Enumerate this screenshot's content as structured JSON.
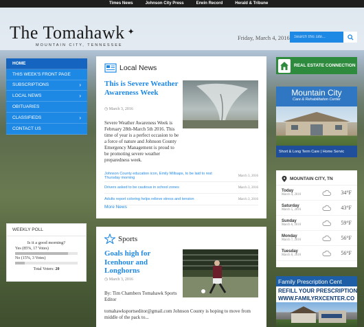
{
  "topbar": {
    "links": [
      "Times News",
      "Johnson City Press",
      "Erwin Record",
      "Herald & Tribune"
    ]
  },
  "header": {
    "logo": "The Tomahawk",
    "tagline": "MOUNTAIN CITY, TENNESSEE",
    "date": "Friday, March 4, 2016",
    "search_placeholder": "Search this site..."
  },
  "nav": {
    "items": [
      {
        "label": "HOME",
        "chev": ""
      },
      {
        "label": "THIS WEEK'S FRONT PAGE",
        "chev": ""
      },
      {
        "label": "SUBSCRIPTIONS",
        "chev": "›"
      },
      {
        "label": "LOCAL NEWS",
        "chev": "›"
      },
      {
        "label": "OBITUARIES",
        "chev": ""
      },
      {
        "label": "CLASSIFIEDS",
        "chev": "›"
      },
      {
        "label": "CONTACT US",
        "chev": ""
      }
    ]
  },
  "poll": {
    "title": "WEEKLY POLL",
    "question": "Is it a good morning?",
    "answers": [
      {
        "label": "Yes (85%, 17 Votes)",
        "percent": 85
      },
      {
        "label": "No (15%, 3 Votes)",
        "percent": 15
      }
    ],
    "total_label": "Total Voters:",
    "total_value": "20"
  },
  "local_news": {
    "section": "Local News",
    "article": {
      "title": "This is Severe Weather Awareness Week",
      "date": "March 3, 2016",
      "body": "Severe Weather Awareness Week is February 28th-March 5th 2016. This time of year is a perfect occasion to be a force of nature and Johnson County Emergency Management is proud to be promoting severe weather preparedness week."
    },
    "related": [
      {
        "title": "Johnson County education icon, Emily Millsaps, to be laid to rest Thursday morning",
        "date": "March 3, 2016"
      },
      {
        "title": "Drivers asked to be cautious in school zones",
        "date": "March 3, 2016"
      },
      {
        "title": "Adults report coloring helps relieve stress and tension",
        "date": "March 3, 2016"
      }
    ],
    "more": "More News"
  },
  "sports": {
    "section": "Sports",
    "article": {
      "title": "Goals high for Icenhour and Longhorns",
      "date": "March 3, 2016",
      "byline": "By:  Tim Chambers Tomahawk Sports Editor",
      "body": "tomahawksportseditor@gmail.com  Johnson County is hoping to move from middle of the pack to..."
    }
  },
  "ads": {
    "real_estate": "REAL ESTATE CONNECTION",
    "mountain_city": {
      "title": "Mountain City",
      "subtitle": "Care & Rehabilitation Center",
      "footer": "Short & Long Term Care | Home Servic"
    },
    "family": {
      "line1": "Family Prescription Cent",
      "line2": "REFILL YOUR PRESCRIPTION",
      "line3": "WWW.FAMILYRXCENTER.CO"
    }
  },
  "weather": {
    "location": "MOUNTAIN CITY, TN",
    "days": [
      {
        "day": "Today",
        "date": "March 4, 2016",
        "temp": "34°F",
        "icon": "cloud-icon"
      },
      {
        "day": "Saturday",
        "date": "March 5, 2016",
        "temp": "43°F",
        "icon": "cloud-icon"
      },
      {
        "day": "Sunday",
        "date": "March 6, 2016",
        "temp": "59°F",
        "icon": "cloud-icon"
      },
      {
        "day": "Monday",
        "date": "March 7, 2016",
        "temp": "56°F",
        "icon": "cloud-icon"
      },
      {
        "day": "Tuesday",
        "date": "March 8, 2016",
        "temp": "56°F",
        "icon": "cloud-icon"
      }
    ]
  },
  "colors": {
    "accent": "#1e88e5",
    "nav_active": "#1565c0"
  }
}
